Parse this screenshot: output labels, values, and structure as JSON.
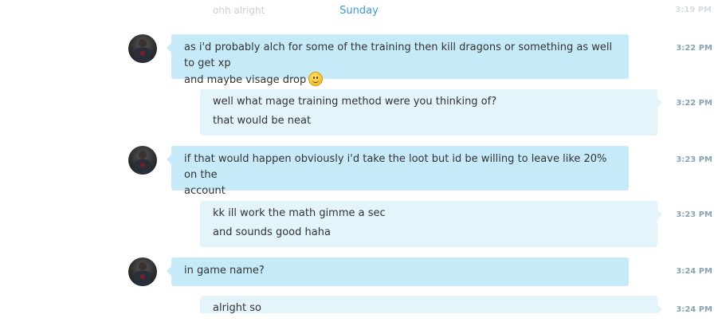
{
  "header": {
    "faded_message": "ohh alright",
    "faded_time": "3:19 PM",
    "date_divider": "Sunday"
  },
  "messages": [
    {
      "from": "them",
      "lines": [
        "as i'd probably alch for some of the training then kill dragons or something as well to get xp",
        "and maybe visage drop"
      ],
      "emoji": "smile-emoji",
      "time": "3:22 PM"
    },
    {
      "from": "me",
      "lines": [
        "well what mage training method were you thinking of?",
        "that would be neat"
      ],
      "time": "3:22 PM"
    },
    {
      "from": "them",
      "lines": [
        "if that would happen obviously i'd take the loot but id be willing to leave like 20% on the",
        "account"
      ],
      "time": "3:23 PM"
    },
    {
      "from": "me",
      "lines": [
        "kk ill work the math gimme a sec",
        "and sounds good haha"
      ],
      "time": "3:23 PM"
    },
    {
      "from": "them",
      "lines": [
        "in game name?"
      ],
      "time": "3:24 PM"
    },
    {
      "from": "me",
      "lines": [
        "alright so"
      ],
      "time": "3:24 PM"
    }
  ],
  "colors": {
    "incoming_bubble": "#c7eaf9",
    "outgoing_bubble": "#e3f4fb",
    "divider_text": "#3a9bd9",
    "timestamp": "#8aa3b3"
  },
  "icons": {
    "avatar": "contact-avatar",
    "emoji": "smile-emoji"
  }
}
